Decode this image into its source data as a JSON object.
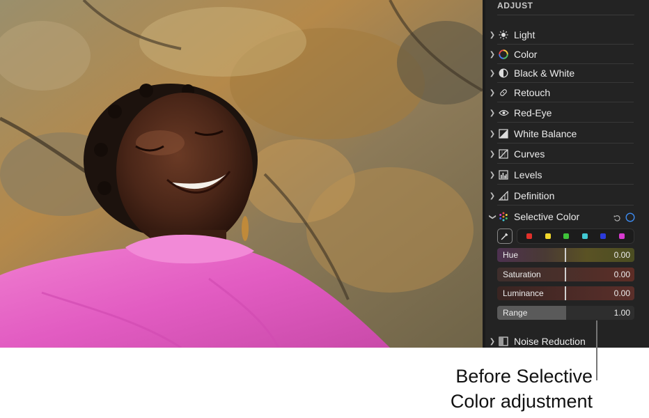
{
  "panel": {
    "title": "ADJUST",
    "items": [
      {
        "label": "Light",
        "icon": "sun-icon"
      },
      {
        "label": "Color",
        "icon": "color-wheel-icon"
      },
      {
        "label": "Black & White",
        "icon": "half-circle-icon"
      },
      {
        "label": "Retouch",
        "icon": "bandage-icon"
      },
      {
        "label": "Red-Eye",
        "icon": "eye-icon"
      },
      {
        "label": "White Balance",
        "icon": "white-balance-icon"
      },
      {
        "label": "Curves",
        "icon": "curves-icon"
      },
      {
        "label": "Levels",
        "icon": "levels-icon"
      },
      {
        "label": "Definition",
        "icon": "triangle-icon"
      }
    ],
    "selective_color": {
      "label": "Selective Color",
      "icon": "color-dots-icon",
      "swatches": [
        "#e1302a",
        "#f2d82c",
        "#3fc33a",
        "#42c9d3",
        "#2b3bdc",
        "#d83bd1"
      ],
      "sliders": {
        "hue": {
          "label": "Hue",
          "value": "0.00"
        },
        "saturation": {
          "label": "Saturation",
          "value": "0.00"
        },
        "luminance": {
          "label": "Luminance",
          "value": "0.00"
        },
        "range": {
          "label": "Range",
          "value": "1.00",
          "level": 0.5
        }
      }
    },
    "noise_reduction": {
      "label": "Noise Reduction",
      "icon": "noise-icon"
    }
  },
  "caption": {
    "line1": "Before Selective",
    "line2": "Color adjustment"
  }
}
